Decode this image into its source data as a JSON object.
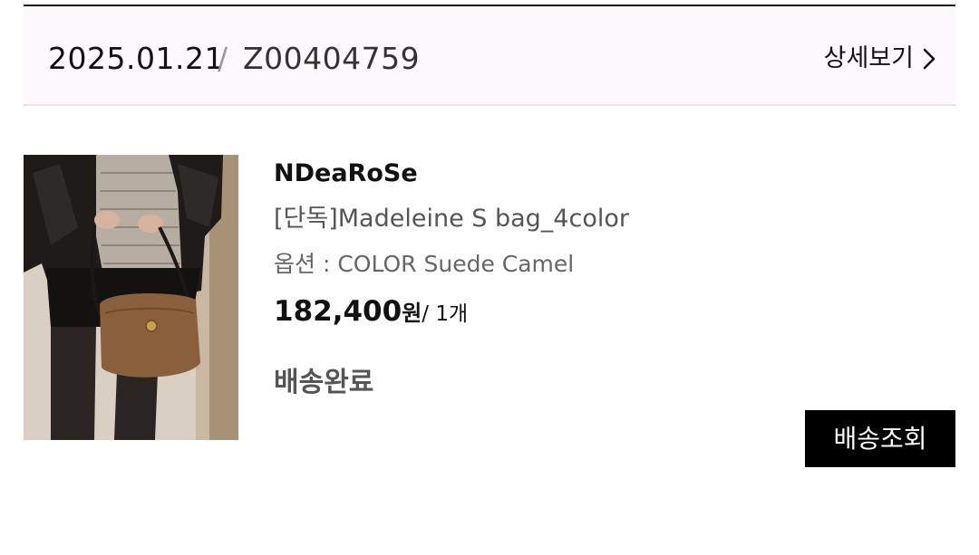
{
  "order": {
    "date": "2025.01.21",
    "separator": "/",
    "number": "Z00404759",
    "detail_label": "상세보기"
  },
  "product": {
    "brand": "NDeaRoSe",
    "name": "[단독]Madeleine S bag_4color",
    "option": "옵션 : COLOR Suede Camel",
    "price": "182,400",
    "currency": "원",
    "quantity": "/ 1개",
    "status": "배송완료",
    "image_icon": "product-photo-bag"
  },
  "actions": {
    "track_label": "배송조회"
  },
  "colors": {
    "header_bg": "#fdf8fb",
    "button_bg": "#000000",
    "button_text": "#ffffff"
  }
}
